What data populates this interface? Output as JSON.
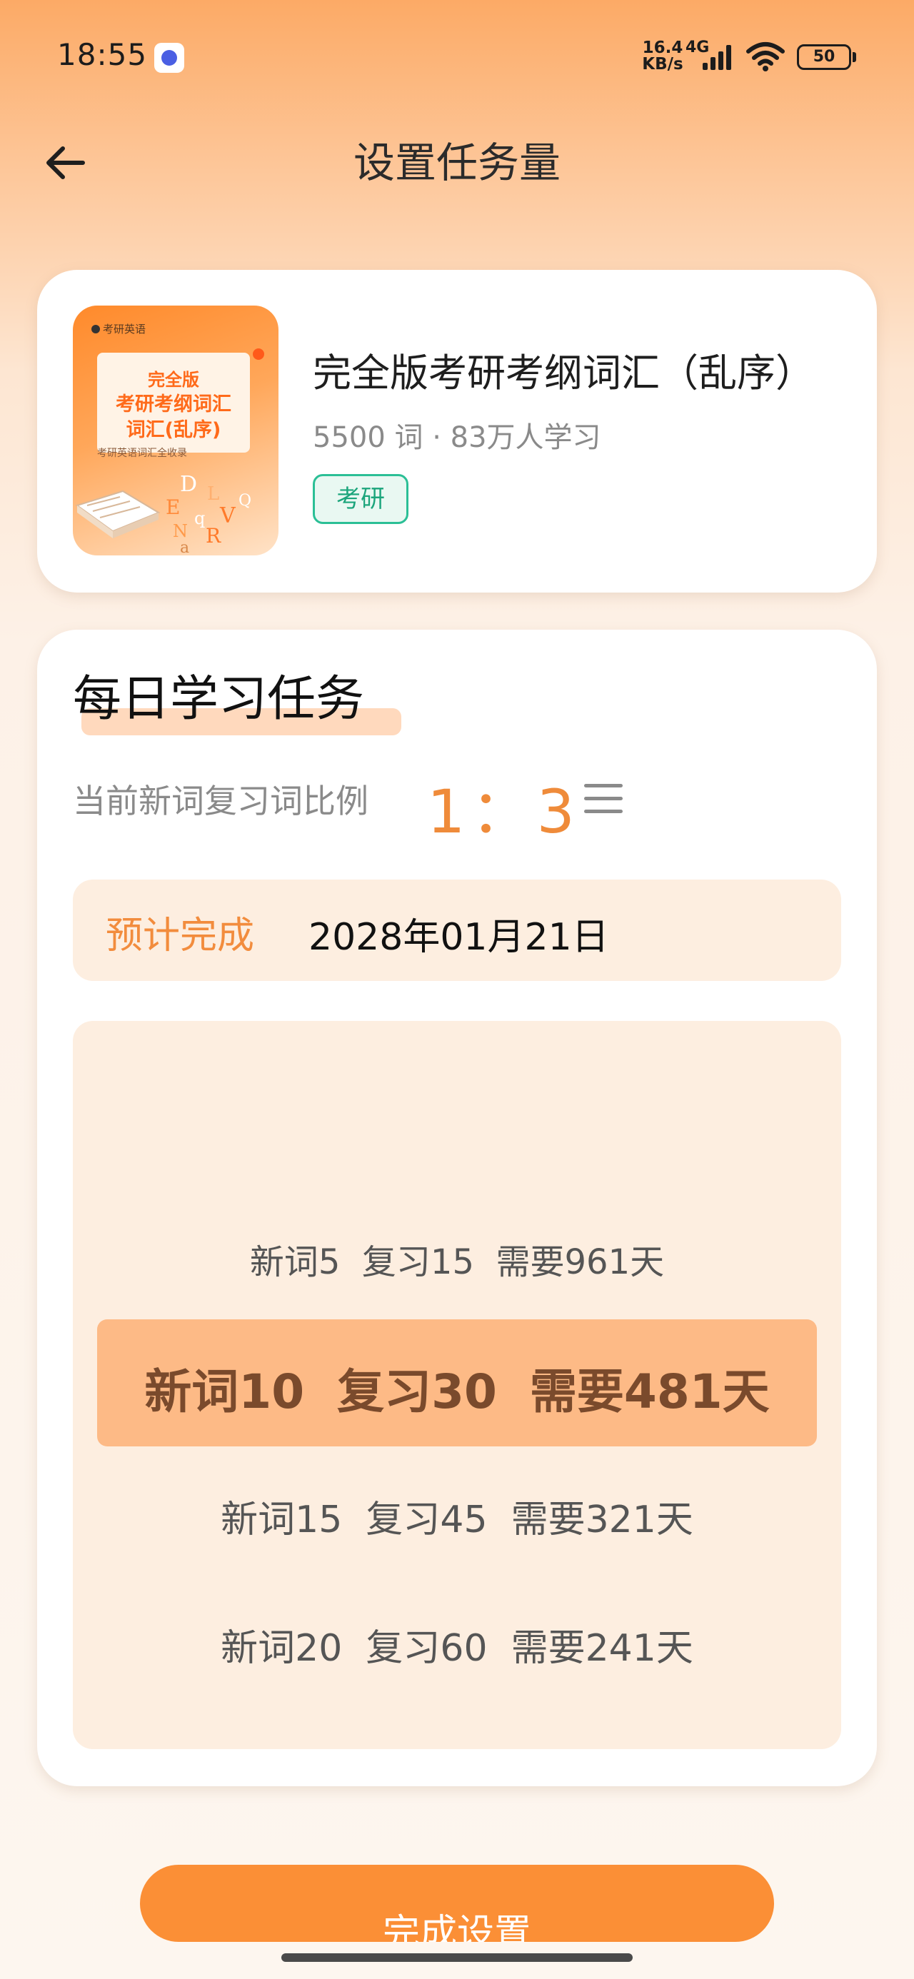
{
  "status_bar": {
    "time": "18:55",
    "net_speed_value": "16.4",
    "net_speed_unit": "KB/s",
    "network_type": "4G",
    "battery": "50"
  },
  "header": {
    "title": "设置任务量",
    "back_icon": "arrow-left-icon"
  },
  "book": {
    "title": "完全版考研考纲词汇（乱序）",
    "meta": "5500 词 · 83万人学习",
    "tag": "考研",
    "cover": {
      "publisher": "考研英语",
      "line1": "完全版",
      "line2": "考研考纲词汇",
      "line3": "词汇(乱序)",
      "subtitle": "考研英语词汇全收录"
    }
  },
  "task": {
    "heading": "每日学习任务",
    "ratio_label": "当前新词复习词比例",
    "ratio_value": "1：3",
    "finish_label": "预计完成",
    "finish_date": "2028年01月21日",
    "options": [
      "新词5  复习15  需要961天",
      "新词10  复习30  需要481天",
      "新词15  复习45  需要321天",
      "新词20  复习60  需要241天"
    ],
    "selected_index": 1
  },
  "done_button": "完成设置",
  "colors": {
    "accent": "#fb8f36",
    "tag_green": "#2bbf96",
    "selected_bg": "#fdba86"
  }
}
